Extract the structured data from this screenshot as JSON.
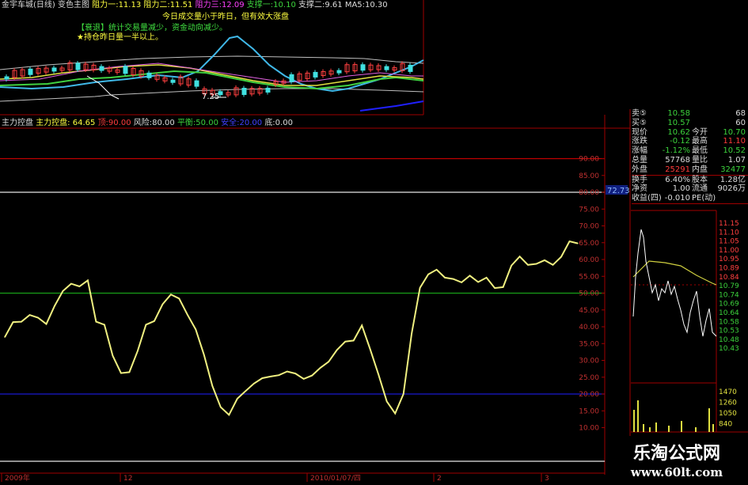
{
  "top_header": {
    "stock": "金宇车城(日线)",
    "formula": "变色主图",
    "r1_label": "阻力一",
    "r1_val": "11.13",
    "r2_label": "阻力二",
    "r2_val": "11.51",
    "r3_label": "阻力三",
    "r3_val": "12.09",
    "s1_label": "支撑一",
    "s1_val": "10.10",
    "s2_label": "支撑二",
    "s2_val": "9.61",
    "ma5": "MA5:10.30",
    "low_price": "7.25"
  },
  "notes": [
    "今日成交量小于昨日，但有效大涨盘",
    "【衰退】统计交易量减少，资金动向减少。",
    "★持仓昨日量一半以上。"
  ],
  "indicator_header": {
    "name": "主力控盘",
    "ctrl": "主力控盘: 64.65",
    "peak": "顶:90.00",
    "risk": "风险:80.00",
    "balance": "平衡:50.00",
    "safe": "安全:20.00",
    "bottom": "底:0.00"
  },
  "chart_data": {
    "type": "line",
    "title": "主力控盘",
    "ylim": [
      0,
      95
    ],
    "y_ticks": [
      10,
      15,
      20,
      25,
      30,
      35,
      40,
      45,
      50,
      55,
      60,
      65,
      70,
      75,
      80,
      85,
      90
    ],
    "reference_lines": [
      {
        "name": "顶",
        "value": 90,
        "color": "#c00000"
      },
      {
        "name": "风险",
        "value": 80,
        "color": "#e6e6e6"
      },
      {
        "name": "平衡",
        "value": 50,
        "color": "#18a018"
      },
      {
        "name": "安全",
        "value": 20,
        "color": "#1a1ad0"
      },
      {
        "name": "底",
        "value": 0,
        "color": "#e6e6e6"
      }
    ],
    "series": [
      {
        "name": "主力控盘",
        "color": "#f0f080",
        "values": [
          36.9,
          41.4,
          41.5,
          43.5,
          42.7,
          40.8,
          46.2,
          50.6,
          52.8,
          52.0,
          53.8,
          41.5,
          40.6,
          31.4,
          26.2,
          26.5,
          32.8,
          40.6,
          41.7,
          46.7,
          49.6,
          48.4,
          43.6,
          39.2,
          31.6,
          22.4,
          16.1,
          13.8,
          18.6,
          20.9,
          23.1,
          24.7,
          25.2,
          25.6,
          26.7,
          26.1,
          24.5,
          25.5,
          27.8,
          29.6,
          33.1,
          35.6,
          35.9,
          40.4,
          33.3,
          25.8,
          17.8,
          14.2,
          20.0,
          38.0,
          51.6,
          55.6,
          57.0,
          54.6,
          54.2,
          53.2,
          55.2,
          53.3,
          54.6,
          51.5,
          51.8,
          58.2,
          60.9,
          58.4,
          58.7,
          59.8,
          58.4,
          60.8,
          65.4,
          64.8
        ]
      }
    ],
    "x_labels": [
      "2009年",
      "12",
      "2010/01/07/四",
      "2",
      "3"
    ]
  },
  "quote": {
    "rows": [
      {
        "k1": "卖⑤",
        "v1": "10.58",
        "c1": "grn",
        "k2": "",
        "v2": "68",
        "c2": "wht"
      },
      {
        "k1": "买⑤",
        "v1": "10.57",
        "c1": "grn",
        "k2": "",
        "v2": "60",
        "c2": "wht"
      },
      {
        "k1": "现价",
        "v1": "10.62",
        "c1": "grn",
        "k2": "今开",
        "v2": "10.70",
        "c2": "grn"
      },
      {
        "k1": "涨跌",
        "v1": "-0.12",
        "c1": "grn",
        "k2": "最高",
        "v2": "11.10",
        "c2": "red"
      },
      {
        "k1": "涨幅",
        "v1": "-1.12%",
        "c1": "grn",
        "k2": "最低",
        "v2": "10.52",
        "c2": "grn"
      },
      {
        "k1": "总量",
        "v1": "57768",
        "c1": "wht",
        "k2": "量比",
        "v2": "1.07",
        "c2": "wht"
      },
      {
        "k1": "外盘",
        "v1": "25291",
        "c1": "red",
        "k2": "内盘",
        "v2": "32477",
        "c2": "grn"
      },
      {
        "k1": "换手",
        "v1": "6.40%",
        "c1": "wht",
        "k2": "股本",
        "v2": "1.28亿",
        "c2": "wht"
      },
      {
        "k1": "净资",
        "v1": "1.00",
        "c1": "wht",
        "k2": "流通",
        "v2": "9026万",
        "c2": "wht"
      },
      {
        "k1": "收益(四)",
        "v1": "-0.010",
        "c1": "wht",
        "k2": "PE(动)",
        "v2": "",
        "c2": "wht"
      }
    ],
    "current_value_tag": "72.73"
  },
  "intraday": {
    "price_ticks": [
      "11.15",
      "11.10",
      "11.05",
      "11.00",
      "10.95",
      "10.89",
      "10.84",
      "10.79",
      "10.74",
      "10.69",
      "10.64",
      "10.58",
      "10.53",
      "10.48",
      "10.43"
    ],
    "vol_ticks": [
      "1470",
      "1260",
      "1050",
      "840"
    ]
  },
  "watermark": {
    "cn": "乐淘公式网",
    "url": "www.60lt.com"
  }
}
